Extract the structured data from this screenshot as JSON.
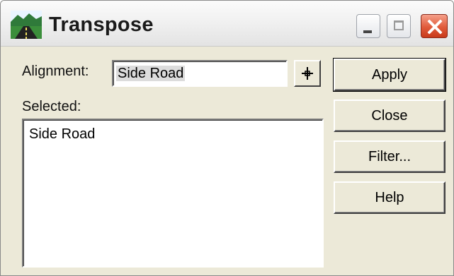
{
  "window": {
    "title": "Transpose"
  },
  "titlebar_buttons": {
    "minimize": "minimize",
    "maximize": "maximize",
    "close": "close"
  },
  "form": {
    "alignment_label": "Alignment:",
    "alignment_value": "Side Road",
    "selected_label": "Selected:",
    "selected_items": [
      "Side Road"
    ]
  },
  "buttons": {
    "apply": "Apply",
    "close": "Close",
    "filter": "Filter...",
    "help": "Help"
  },
  "icons": {
    "app": "road-icon",
    "pick": "crosshair-icon"
  },
  "colors": {
    "dialog_bg": "#ece9d8",
    "close_button": "#e05a3a"
  }
}
